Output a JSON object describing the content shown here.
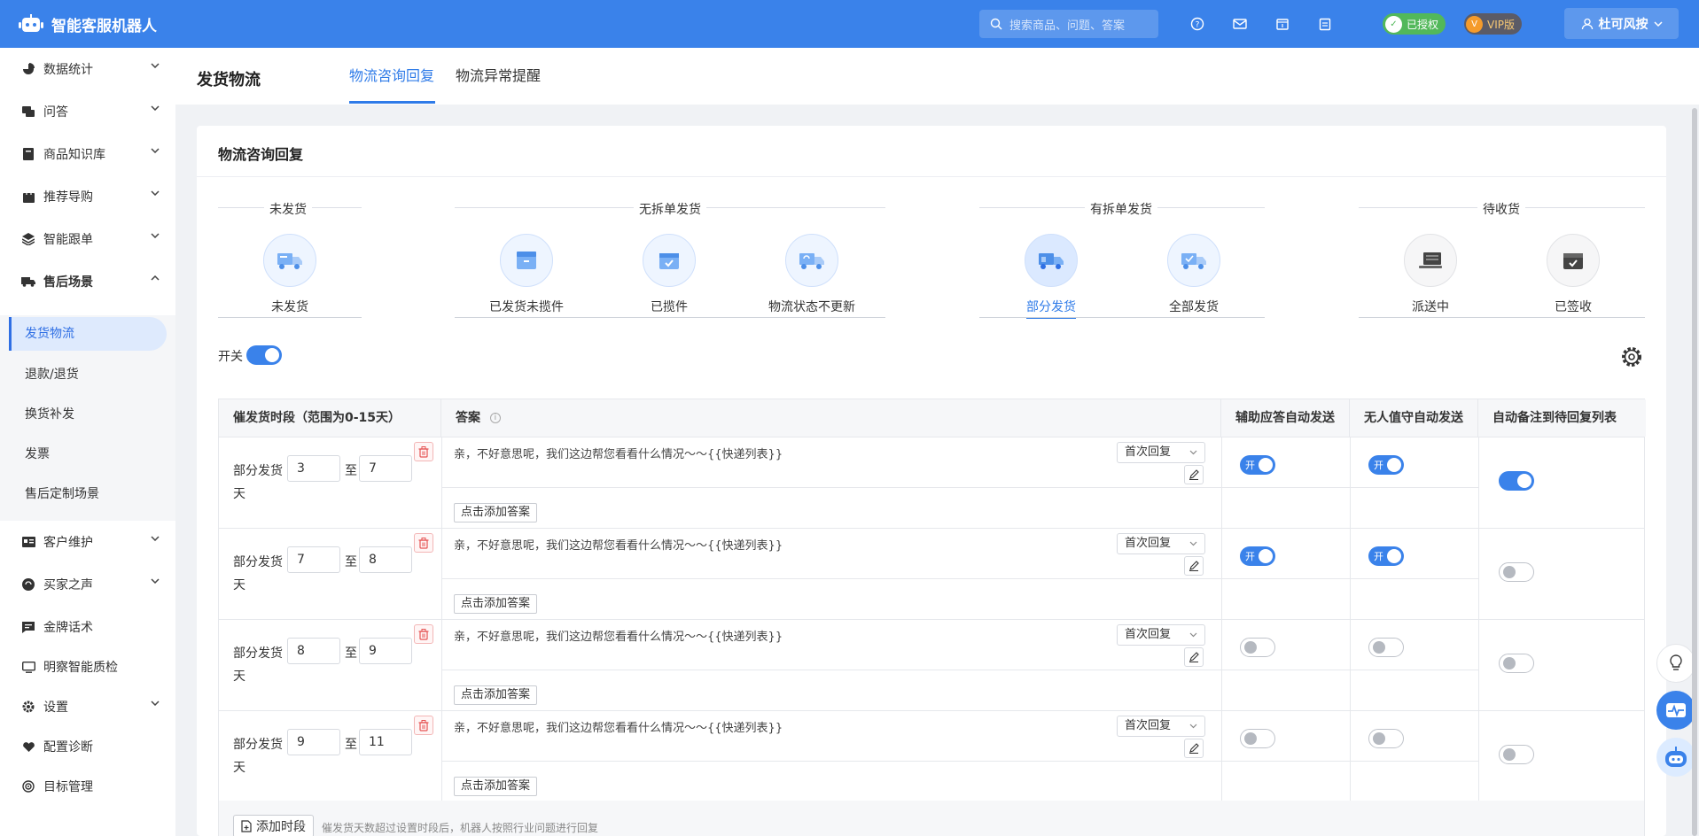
{
  "app": {
    "title": "智能客服机器人"
  },
  "topbar": {
    "search_placeholder": "搜索商品、问题、答案",
    "auth_badge": "已授权",
    "vip_badge": "VIP版",
    "user_name": "杜可风按"
  },
  "sidebar": {
    "items": [
      {
        "label": "数据统计"
      },
      {
        "label": "问答"
      },
      {
        "label": "商品知识库"
      },
      {
        "label": "推荐导购"
      },
      {
        "label": "智能跟单"
      },
      {
        "label": "售后场景"
      },
      {
        "label": "客户维护"
      },
      {
        "label": "买家之声"
      },
      {
        "label": "金牌话术"
      },
      {
        "label": "明察智能质检"
      },
      {
        "label": "设置"
      },
      {
        "label": "配置诊断"
      },
      {
        "label": "目标管理"
      }
    ],
    "sub_items": [
      {
        "label": "发货物流"
      },
      {
        "label": "退款/退货"
      },
      {
        "label": "换货补发"
      },
      {
        "label": "发票"
      },
      {
        "label": "售后定制场景"
      }
    ]
  },
  "page": {
    "title": "发货物流",
    "tabs": [
      {
        "label": "物流咨询回复"
      },
      {
        "label": "物流异常提醒"
      }
    ]
  },
  "card": {
    "title": "物流咨询回复",
    "groups": [
      {
        "title": "未发货",
        "statuses": [
          {
            "label": "未发货"
          }
        ]
      },
      {
        "title": "无拆单发货",
        "statuses": [
          {
            "label": "已发货未揽件"
          },
          {
            "label": "已揽件"
          },
          {
            "label": "物流状态不更新"
          }
        ]
      },
      {
        "title": "有拆单发货",
        "statuses": [
          {
            "label": "部分发货"
          },
          {
            "label": "全部发货"
          }
        ]
      },
      {
        "title": "待收货",
        "statuses": [
          {
            "label": "派送中"
          },
          {
            "label": "已签收"
          }
        ]
      }
    ],
    "selected_status": "部分发货",
    "switch_label": "开关",
    "switch_on": true
  },
  "table": {
    "headers": [
      "催发货时段（范围为0-15天）",
      "答案",
      "辅助应答自动发送",
      "无人值守自动发送",
      "自动备注到待回复列表"
    ],
    "row_prefix": "部分发货",
    "row_to": "至",
    "row_suffix": "天",
    "rows": [
      {
        "from": "3",
        "to": "7",
        "answer": "亲，不好意思呢，我们这边帮您看看什么情况～～{{快递列表}}",
        "reply_type": "首次回复",
        "assist_auto": true,
        "unattended_auto": true,
        "auto_note": true
      },
      {
        "from": "7",
        "to": "8",
        "answer": "亲，不好意思呢，我们这边帮您看看什么情况～～{{快递列表}}",
        "reply_type": "首次回复",
        "assist_auto": true,
        "unattended_auto": true,
        "auto_note": false
      },
      {
        "from": "8",
        "to": "9",
        "answer": "亲，不好意思呢，我们这边帮您看看什么情况～～{{快递列表}}",
        "reply_type": "首次回复",
        "assist_auto": false,
        "unattended_auto": false,
        "auto_note": false
      },
      {
        "from": "9",
        "to": "11",
        "answer": "亲，不好意思呢，我们这边帮您看看什么情况～～{{快递列表}}",
        "reply_type": "首次回复",
        "assist_auto": false,
        "unattended_auto": false,
        "auto_note": false
      }
    ],
    "add_answer": "点击添加答案",
    "toggle_on_text": "开",
    "add_segment": "添加时段",
    "footer_hint": "催发货天数超过设置时段后，机器人按照行业问题进行回复"
  }
}
